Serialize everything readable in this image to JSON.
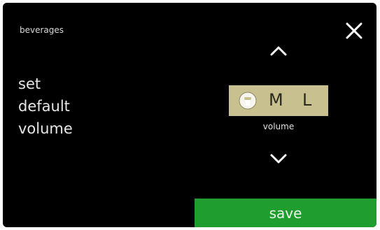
{
  "header": {
    "breadcrumb": "beverages"
  },
  "setting": {
    "line1": "set",
    "line2": "default",
    "line3": "volume"
  },
  "selector": {
    "options": [
      "M",
      "L"
    ],
    "caption": "volume",
    "icon": "cup-icon"
  },
  "actions": {
    "save_label": "save"
  },
  "icons": {
    "close": "close-icon",
    "up": "chevron-up-icon",
    "down": "chevron-down-icon"
  },
  "colors": {
    "background": "#000000",
    "selector_bg": "#c8c08e",
    "save_bg": "#1f9e2f",
    "text": "#e6e6e6"
  }
}
